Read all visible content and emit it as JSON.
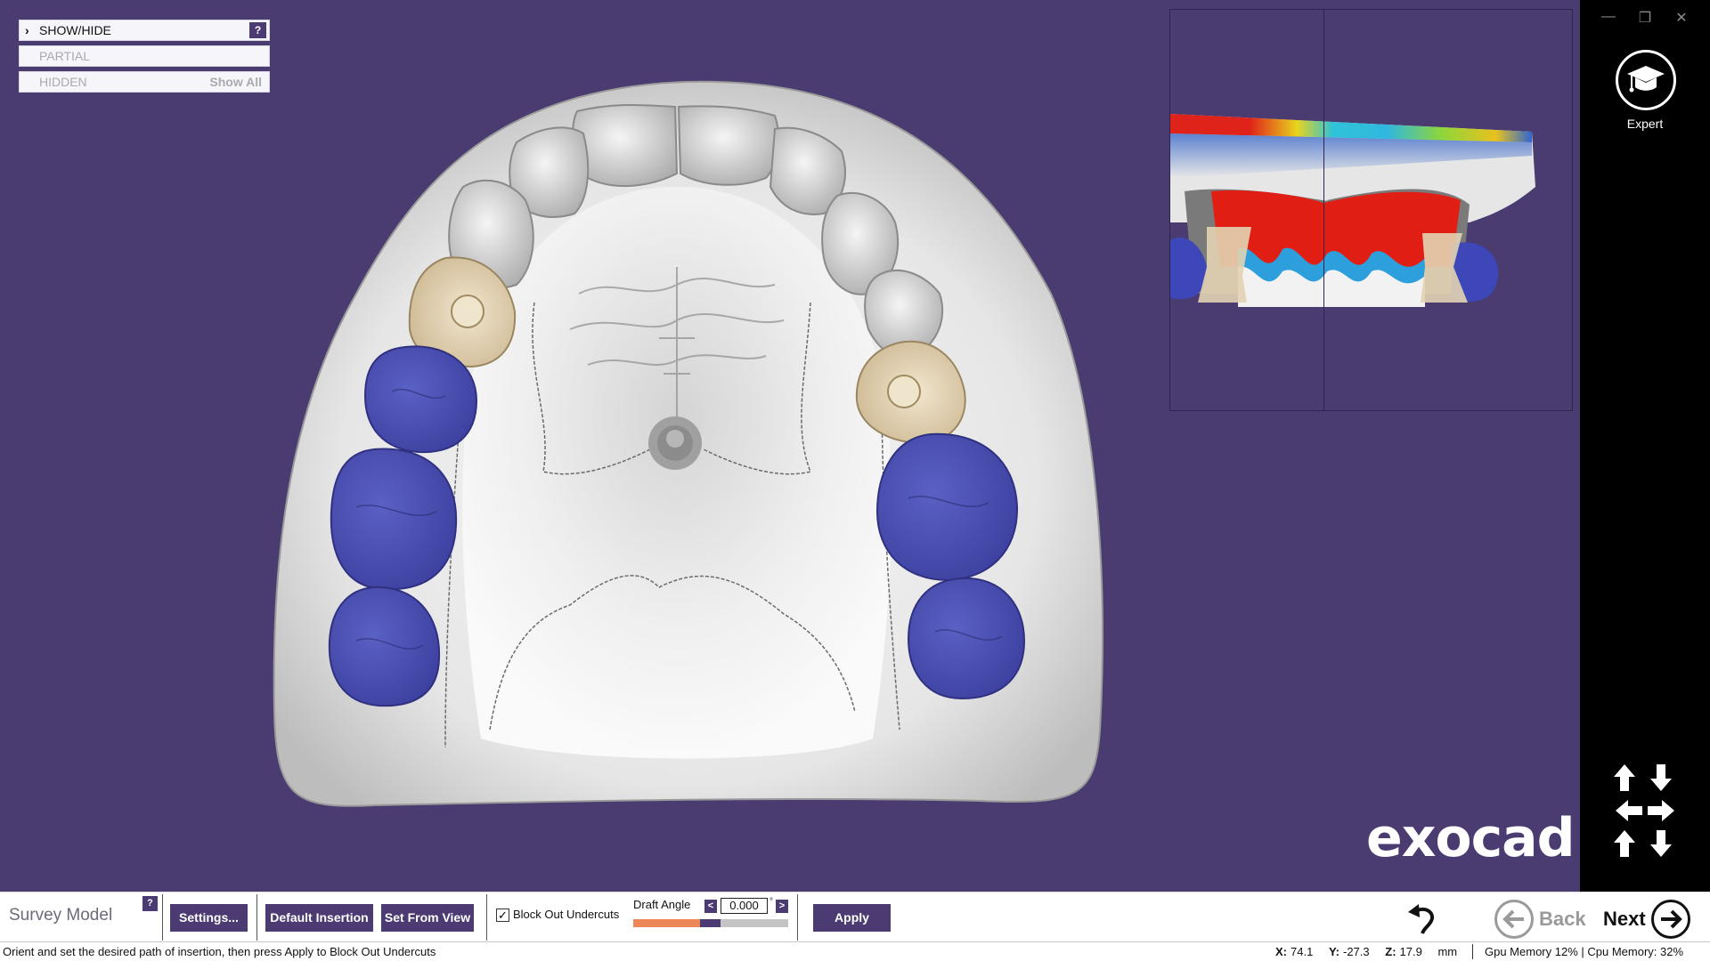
{
  "app": {
    "logo": "exocad"
  },
  "show_hide_panel": {
    "header": "SHOW/HIDE",
    "help": "?",
    "rows": [
      {
        "label": "PARTIAL",
        "action": ""
      },
      {
        "label": "HIDDEN",
        "action": "Show All"
      }
    ]
  },
  "window_controls": {
    "minimize": "—",
    "restore": "❐",
    "close": "✕"
  },
  "sidebar": {
    "expert_label": "Expert",
    "expert_icon": "graduation-cap-icon",
    "view_icon": "view-direction-arrows-icon"
  },
  "toolbar": {
    "title": "Survey Model",
    "help": "?",
    "settings": "Settings...",
    "default_insertion": "Default Insertion",
    "set_from_view": "Set From View",
    "block_out_checked": true,
    "block_out_label": "Block Out Undercuts",
    "draft_angle_label": "Draft Angle",
    "draft_angle_value": "0.000",
    "draft_angle_unit": "°",
    "draft_slider_fraction": 0.43,
    "apply": "Apply",
    "back": "Back",
    "next": "Next"
  },
  "status_bar": {
    "message": "Orient and set the desired path of insertion, then press Apply to Block Out Undercuts",
    "x_label": "X:",
    "x_value": "74.1",
    "y_label": "Y:",
    "y_value": "-27.3",
    "z_label": "Z:",
    "z_value": "17.9",
    "unit": "mm",
    "memory": "Gpu Memory 12% | Cpu Memory: 32%"
  },
  "colors": {
    "background": "#4a3b71",
    "accent": "#4b3b72",
    "slider_fill": "#ee8757",
    "model_gray": "#e4e4e4",
    "tooth_blue": "#4a4fb0",
    "tooth_beige": "#e3d3b2"
  }
}
